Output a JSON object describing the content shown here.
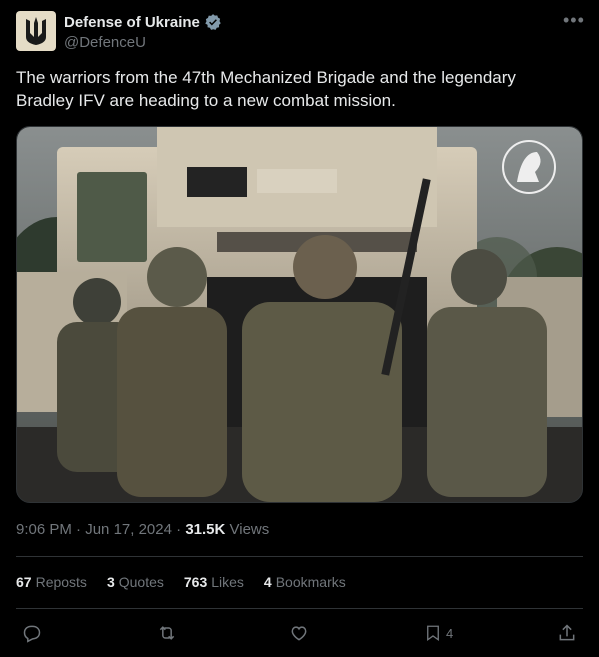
{
  "author": {
    "name": "Defense of Ukraine",
    "handle": "@DefenceU"
  },
  "tweet_text": "The warriors from the 47th Mechanized Brigade and the legendary Bradley IFV are heading to a new combat mission.",
  "meta": {
    "time": "9:06 PM",
    "date": "Jun 17, 2024",
    "views_count": "31.5K",
    "views_label": "Views",
    "sep1": "·",
    "sep2": "·"
  },
  "stats": [
    {
      "count": "67",
      "label": "Reposts"
    },
    {
      "count": "3",
      "label": "Quotes"
    },
    {
      "count": "763",
      "label": "Likes"
    },
    {
      "count": "4",
      "label": "Bookmarks"
    }
  ],
  "actions": {
    "bookmark_count": "4"
  },
  "icons": [
    "verified-badge-icon",
    "more-icon",
    "reply-icon",
    "repost-icon",
    "like-icon",
    "bookmark-icon",
    "share-icon"
  ],
  "colors": {
    "verified": "#829aab",
    "muted": "#71767b",
    "text": "#e7e9ea"
  }
}
